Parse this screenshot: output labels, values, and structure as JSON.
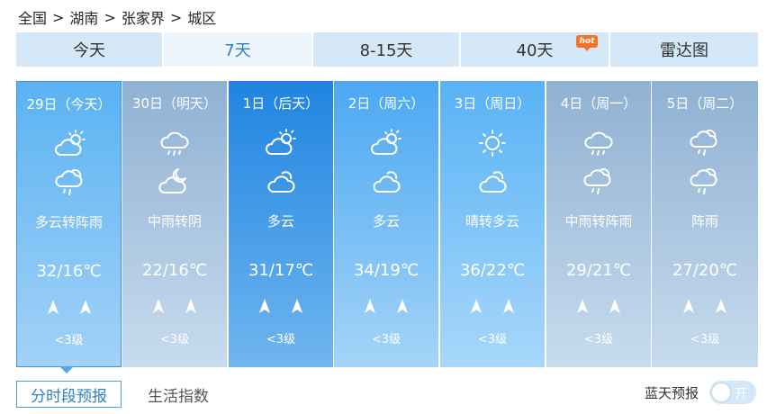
{
  "breadcrumb": [
    "全国",
    "湖南",
    "张家界",
    "城区"
  ],
  "breadcrumb_sep": ">",
  "tabs": [
    {
      "label": "今天",
      "active": false,
      "badge": ""
    },
    {
      "label": "7天",
      "active": true,
      "badge": ""
    },
    {
      "label": "8-15天",
      "active": false,
      "badge": ""
    },
    {
      "label": "40天",
      "active": false,
      "badge": "hot"
    },
    {
      "label": "雷达图",
      "active": false,
      "badge": ""
    }
  ],
  "days": [
    {
      "date": "29日（今天）",
      "weather": "多云转阵雨",
      "temp": "32/16℃",
      "wind_level": "<3级",
      "icon1": "partly-cloudy-icon",
      "icon2": "cloud-rain-sun-icon",
      "bg": [
        "#5ab2f3",
        "#a3d2f7"
      ],
      "selected": true
    },
    {
      "date": "30日（明天）",
      "weather": "中雨转阴",
      "temp": "22/16℃",
      "wind_level": "<3级",
      "icon1": "rain-icon",
      "icon2": "cloudy-night-icon",
      "bg": [
        "#8fb1d2",
        "#c7dbee"
      ],
      "selected": false
    },
    {
      "date": "1日（后天）",
      "weather": "多云",
      "temp": "31/17℃",
      "wind_level": "<3级",
      "icon1": "partly-cloudy-icon",
      "icon2": "cloudy-icon",
      "bg": [
        "#1f84e0",
        "#70b6f0"
      ],
      "selected": false
    },
    {
      "date": "2日（周六）",
      "weather": "多云",
      "temp": "34/19℃",
      "wind_level": "<3级",
      "icon1": "partly-cloudy-icon",
      "icon2": "cloudy-icon",
      "bg": [
        "#4ba8f2",
        "#a4d4f8"
      ],
      "selected": false
    },
    {
      "date": "3日（周日）",
      "weather": "晴转多云",
      "temp": "36/22℃",
      "wind_level": "<3级",
      "icon1": "sun-icon",
      "icon2": "cloudy-icon",
      "bg": [
        "#58b2f5",
        "#a8d7fa"
      ],
      "selected": false
    },
    {
      "date": "4日（周一）",
      "weather": "中雨转阵雨",
      "temp": "29/21℃",
      "wind_level": "<3级",
      "icon1": "rain-icon",
      "icon2": "cloud-rain-sun-icon",
      "bg": [
        "#8fb1d2",
        "#c7dbee"
      ],
      "selected": false
    },
    {
      "date": "5日（周二）",
      "weather": "阵雨",
      "temp": "27/20℃",
      "wind_level": "<3级",
      "icon1": "cloud-rain-sun-icon",
      "icon2": "cloud-rain-sun-icon",
      "bg": [
        "#8fb1d2",
        "#c7dbee"
      ],
      "selected": false
    }
  ],
  "bottom_tabs": {
    "hourly": "分时段预报",
    "life": "生活指数"
  },
  "bluesky": {
    "label": "蓝天预报",
    "toggle": "开"
  }
}
